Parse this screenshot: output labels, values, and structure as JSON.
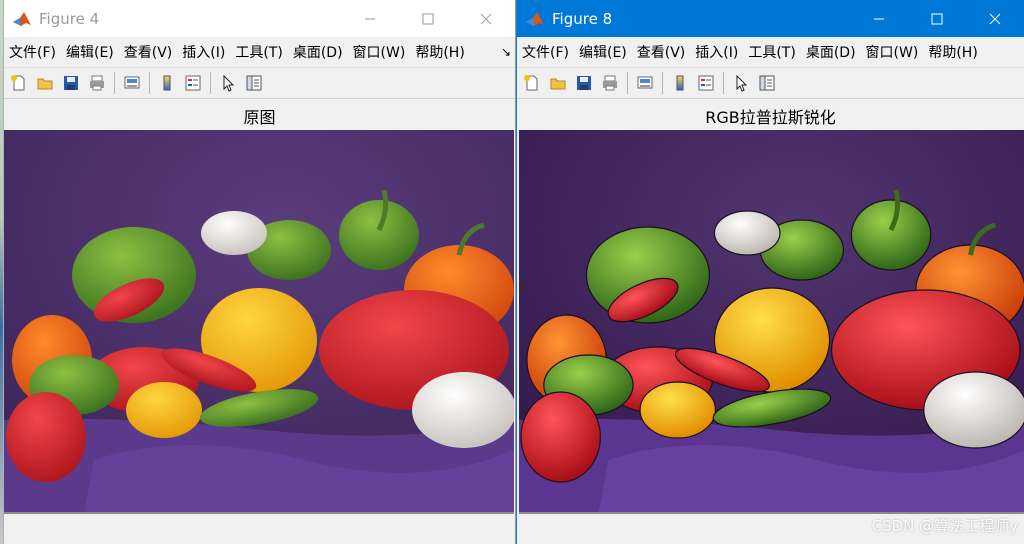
{
  "figures": [
    {
      "window_title": "Figure 4",
      "menu": [
        "文件(F)",
        "编辑(E)",
        "查看(V)",
        "插入(I)",
        "工具(T)",
        "桌面(D)",
        "窗口(W)",
        "帮助(H)"
      ],
      "axes_title": "原图",
      "active": false
    },
    {
      "window_title": "Figure 8",
      "menu": [
        "文件(F)",
        "编辑(E)",
        "查看(V)",
        "插入(I)",
        "工具(T)",
        "桌面(D)",
        "窗口(W)",
        "帮助(H)"
      ],
      "axes_title": "RGB拉普拉斯锐化",
      "active": true
    }
  ],
  "menu_overflow_glyph": "↘",
  "toolbar_icons": [
    "new-figure-icon",
    "open-folder-icon",
    "save-disk-icon",
    "print-icon",
    "link-plot-icon",
    "colorbar-icon",
    "legend-icon",
    "pointer-icon",
    "property-inspector-icon"
  ],
  "image_subject": "peppers",
  "watermark": "CSDN @算法工程师y",
  "colors": {
    "active_titlebar": "#0078d7",
    "inactive_titlebar": "#ffffff",
    "backdrop_purple": "#4a2e6e",
    "cloth_purple": "#5b3a8c"
  }
}
